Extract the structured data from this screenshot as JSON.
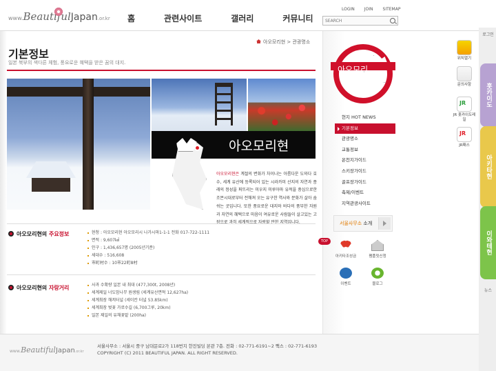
{
  "site": {
    "logo_www": "www.",
    "logo_beautiful": "Beautiful",
    "logo_japan": "Japan",
    "logo_kr": ".or.kr"
  },
  "gnb": [
    "홈",
    "관련사이트",
    "갤러리",
    "커뮤니티"
  ],
  "util": [
    "LOGIN",
    "JOIN",
    "SITEMAP"
  ],
  "search": {
    "placeholder": "SEARCH"
  },
  "page": {
    "title": "기본정보",
    "subtitle": "일본 북부의 색다른 체험, 풍요로운 혜택을 받은 꿈의 대지.",
    "breadcrumb": [
      "아오모리현",
      "관광명소"
    ]
  },
  "visual": {
    "prefecture": "아오모리현"
  },
  "intro": {
    "highlight": "아오모리현은",
    "text": "계절의 변화가 차이나는 아름다운 도와다 호수, 세계 유산에 등록되어 있는 시라카미 산지의 자연과 종래의 정성을 퍼뜨리는 미우지 미루아마 유적을 중심으로한 조몬시대로부터 전해져 오는 유구한 역사와 문화가 살아 숨쉬는 곳입니다. 또한 풍요로운 대지와 바다의 풍부한 자원과 자연의 혜택으로 마음이 여유로운 사람들이 살고있는 고장으로 과히 세계적으로 자랑할 만한 지역입니다."
  },
  "main_info": {
    "head_prefix": "아오모리현의 ",
    "head_accent": "주요정보",
    "items": [
      "현청 : 아오모리현 아오모리시 나가시마1-1-1 전화 017-722-1111",
      "면적 : 9,607㎢",
      "인구 : 1,436,657명 (2005년기준)",
      "세대수 : 516,608",
      "市町村수 : 10市22町8村"
    ]
  },
  "pride": {
    "head_prefix": "아오모리현의 ",
    "head_accent": "자랑거리",
    "items": [
      "사과 수확량 일본 내 최대 (477,300t, 2008년)",
      "세계제일 너도밤나무 원생림 (세계유산면적 12,627ha)",
      "세계최장 해저터널 (세이칸 터널 53.85km)",
      "세계최장 벚꽃 가로수길 (6,700그루, 20km)",
      "일본 제일의 유채꽃밭 (200ha)"
    ]
  },
  "emblem": {
    "label": "아오모리"
  },
  "lnb": [
    {
      "label": "현지 HOT NEWS",
      "active": false
    },
    {
      "label": "기본정보",
      "active": true
    },
    {
      "label": "관광명소",
      "active": false
    },
    {
      "label": "교통정보",
      "active": false
    },
    {
      "label": "온천지가이드",
      "active": false
    },
    {
      "label": "스키장가이드",
      "active": false
    },
    {
      "label": "골프장가이드",
      "active": false
    },
    {
      "label": "축제/이벤트",
      "active": false
    },
    {
      "label": "지역관광사이트",
      "active": false
    }
  ],
  "seoul_office": {
    "accent": "서울사무소",
    "rest": " 소개"
  },
  "top_label": "TOP",
  "quick": [
    "아키타조성금",
    "팸플릿신청",
    "이벤트",
    "블로그"
  ],
  "side_tabs": {
    "top": "로그인",
    "hokkaido": "홋카이도",
    "akita": "아키타현",
    "iwate": "이와테현",
    "bottom": "뉴스"
  },
  "quick_right": [
    "위치열기",
    "문의사항",
    "JR 홋카이도레일",
    "JR패스"
  ],
  "footer": {
    "address": "서울사무소 : 서울시 중구 남대문로2가 118번지 한진빌딩 본관 7층. 전화 : 02-771-6191~2 팩스 : 02-771-6193",
    "copyright": "COPYRIGHT (C) 2011 BEAUTIFUL JAPAN. ALL RIGHT RESERVED."
  }
}
